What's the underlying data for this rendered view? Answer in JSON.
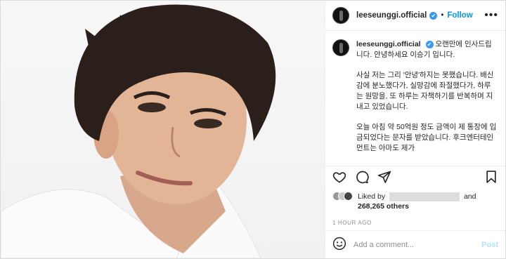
{
  "header": {
    "username": "leeseunggi.official",
    "verified_mark": "✔",
    "separator": "•",
    "follow_label": "Follow",
    "more_label": "•••"
  },
  "caption": {
    "username": "leeseunggi.official",
    "verified_mark": "✔",
    "paragraphs": [
      "오랜만에 인사드립니다. 안녕하세요 이승기 입니다.",
      "사실 저는 그리 '안녕'하지는 못했습니다. 배신감에 분노했다가, 실망감에 좌절했다가, 하루는 원망을, 또 하루는 자책하기를 반복하며 지내고 있었습니다.",
      "오늘 아침 약 50억원 정도 금액이 제 통장에 입금되었다는 문자를 받았습니다. 후크엔터테인먼트는 아마도 제가"
    ]
  },
  "actions": {
    "icons": [
      "heart-icon",
      "comment-icon",
      "share-icon",
      "bookmark-icon"
    ]
  },
  "likes": {
    "prefix": "Liked by",
    "and": "and",
    "count": "268,265 others"
  },
  "timestamp": "1 HOUR AGO",
  "comment": {
    "placeholder": "Add a comment...",
    "post_label": "Post"
  },
  "colors": {
    "link": "#0095f6",
    "verified": "#3897f0",
    "post_disabled": "#b2dffc"
  }
}
